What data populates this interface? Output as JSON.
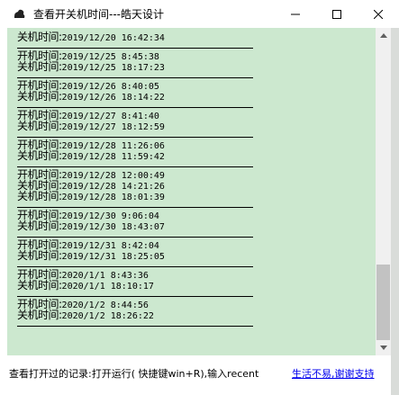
{
  "window": {
    "title": "查看开关机时间---皓天设计"
  },
  "records": [
    {
      "lines": [
        {
          "label": "关机时间:",
          "value": "2019/12/20 16:42:34"
        }
      ]
    },
    {
      "lines": [
        {
          "label": "开机时间:",
          "value": "2019/12/25 8:45:38"
        },
        {
          "label": "关机时间:",
          "value": "2019/12/25 18:17:23"
        }
      ]
    },
    {
      "lines": [
        {
          "label": "开机时间:",
          "value": "2019/12/26 8:40:05"
        },
        {
          "label": "关机时间:",
          "value": "2019/12/26 18:14:22"
        }
      ]
    },
    {
      "lines": [
        {
          "label": "开机时间:",
          "value": "2019/12/27 8:41:40"
        },
        {
          "label": "关机时间:",
          "value": "2019/12/27 18:12:59"
        }
      ]
    },
    {
      "lines": [
        {
          "label": "开机时间:",
          "value": "2019/12/28 11:26:06"
        },
        {
          "label": "关机时间:",
          "value": "2019/12/28 11:59:42"
        }
      ]
    },
    {
      "lines": [
        {
          "label": "开机时间:",
          "value": "2019/12/28 12:00:49"
        },
        {
          "label": "关机时间:",
          "value": "2019/12/28 14:21:26"
        },
        {
          "label": "关机时间:",
          "value": "2019/12/28 18:01:39"
        }
      ]
    },
    {
      "lines": [
        {
          "label": "开机时间:",
          "value": "2019/12/30 9:06:04"
        },
        {
          "label": "关机时间:",
          "value": "2019/12/30 18:43:07"
        }
      ]
    },
    {
      "lines": [
        {
          "label": "开机时间:",
          "value": "2019/12/31 8:42:04"
        },
        {
          "label": "关机时间:",
          "value": "2019/12/31 18:25:05"
        }
      ]
    },
    {
      "lines": [
        {
          "label": "开机时间:",
          "value": "2020/1/1 8:43:36"
        },
        {
          "label": "关机时间:",
          "value": "2020/1/1 18:10:17"
        }
      ]
    },
    {
      "lines": [
        {
          "label": "开机时间:",
          "value": "2020/1/2 8:44:56"
        },
        {
          "label": "关机时间:",
          "value": "2020/1/2 18:26:22"
        }
      ]
    }
  ],
  "footer": {
    "hint": "查看打开过的记录:打开运行( 快捷键win+R),输入recent",
    "link": "生活不易,谢谢支持"
  },
  "colors": {
    "content_bg": "#cce8cf",
    "link": "#0000ee"
  }
}
